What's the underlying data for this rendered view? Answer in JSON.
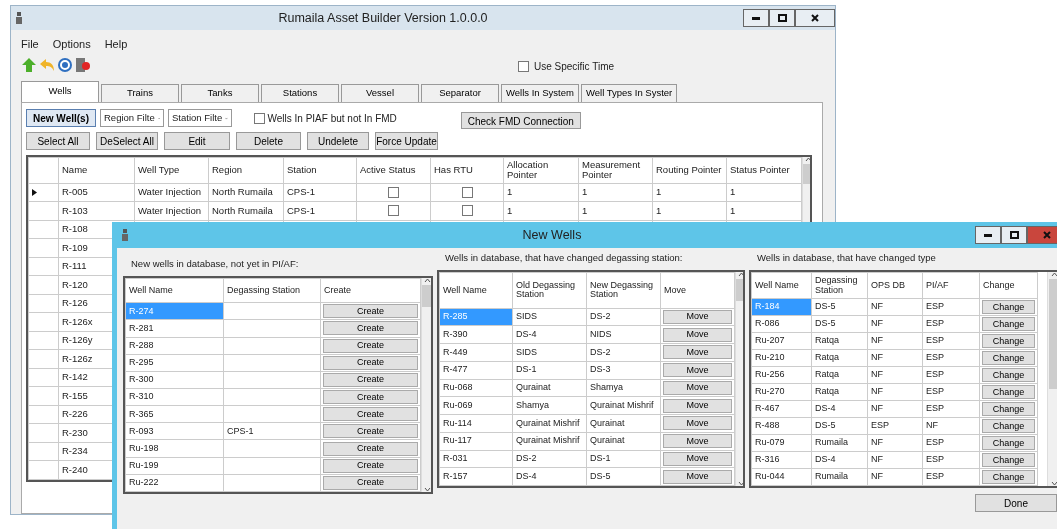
{
  "main_window": {
    "title": "Rumaila Asset Builder Version 1.0.0.0",
    "menu": [
      "File",
      "Options",
      "Help"
    ],
    "use_specific_time": {
      "label": "Use Specific Time",
      "checked": false
    },
    "tabs": [
      {
        "label": "Wells",
        "selected": true
      },
      {
        "label": "Trains",
        "selected": false
      },
      {
        "label": "Tanks",
        "selected": false
      },
      {
        "label": "Stations",
        "selected": false
      },
      {
        "label": "Vessel",
        "selected": false
      },
      {
        "label": "Separator",
        "selected": false
      },
      {
        "label": "Wells In System",
        "selected": false
      },
      {
        "label": "Well Types In Syster",
        "selected": false
      }
    ],
    "new_wells_button": "New Well(s)",
    "filters": [
      {
        "value": "Region Filte"
      },
      {
        "value": "Station Filte"
      }
    ],
    "piaf_checkbox": {
      "label": "Wells In PIAF but not In FMD",
      "checked": false
    },
    "check_fmd_button": "Check FMD Connection",
    "buttons": [
      "Select All",
      "DeSelect All",
      "Edit",
      "Delete",
      "Undelete",
      "Force Update"
    ],
    "table": {
      "columns": [
        "Name",
        "Well Type",
        "Region",
        "Station",
        "Active Status",
        "Has RTU",
        "Allocation Pointer",
        "Measurement Pointer",
        "Routing Pointer",
        "Status Pointer"
      ],
      "rows": [
        {
          "current": true,
          "name": "R-005",
          "well_type": "Water Injection",
          "region": "North Rumaila",
          "station": "CPS-1",
          "active_status": false,
          "has_rtu": false,
          "pointers": [
            "1",
            "1",
            "1",
            "1"
          ]
        },
        {
          "current": false,
          "name": "R-103",
          "well_type": "Water Injection",
          "region": "North Rumaila",
          "station": "CPS-1",
          "active_status": false,
          "has_rtu": false,
          "pointers": [
            "1",
            "1",
            "1",
            "1"
          ]
        },
        {
          "current": false,
          "name": "R-108"
        },
        {
          "current": false,
          "name": "R-109"
        },
        {
          "current": false,
          "name": "R-111"
        },
        {
          "current": false,
          "name": "R-120"
        },
        {
          "current": false,
          "name": "R-126"
        },
        {
          "current": false,
          "name": "R-126x"
        },
        {
          "current": false,
          "name": "R-126y"
        },
        {
          "current": false,
          "name": "R-126z"
        },
        {
          "current": false,
          "name": "R-142"
        },
        {
          "current": false,
          "name": "R-155"
        },
        {
          "current": false,
          "name": "R-226"
        },
        {
          "current": false,
          "name": "R-230"
        },
        {
          "current": false,
          "name": "R-234"
        },
        {
          "current": false,
          "name": "R-240"
        }
      ]
    }
  },
  "dialog": {
    "title": "New Wells",
    "panels": [
      {
        "label": "New wells in database, not yet in PI/AF:",
        "columns": [
          "Well Name",
          "Degassing Station",
          "Create"
        ],
        "rows": [
          {
            "cells": [
              "R-274",
              ""
            ],
            "action": "Create",
            "selected": true
          },
          {
            "cells": [
              "R-281",
              ""
            ],
            "action": "Create",
            "selected": false
          },
          {
            "cells": [
              "R-288",
              ""
            ],
            "action": "Create",
            "selected": false
          },
          {
            "cells": [
              "R-295",
              ""
            ],
            "action": "Create",
            "selected": false
          },
          {
            "cells": [
              "R-300",
              ""
            ],
            "action": "Create",
            "selected": false
          },
          {
            "cells": [
              "R-310",
              ""
            ],
            "action": "Create",
            "selected": false
          },
          {
            "cells": [
              "R-365",
              ""
            ],
            "action": "Create",
            "selected": false
          },
          {
            "cells": [
              "R-093",
              "CPS-1"
            ],
            "action": "Create",
            "selected": false
          },
          {
            "cells": [
              "Ru-198",
              ""
            ],
            "action": "Create",
            "selected": false
          },
          {
            "cells": [
              "Ru-199",
              ""
            ],
            "action": "Create",
            "selected": false
          },
          {
            "cells": [
              "Ru-222",
              ""
            ],
            "action": "Create",
            "selected": false
          }
        ]
      },
      {
        "label": "Wells in database, that have changed degassing station:",
        "columns": [
          "Well Name",
          "Old Degassing Station",
          "New Degassing Station",
          "Move"
        ],
        "rows": [
          {
            "cells": [
              "R-285",
              "SIDS",
              "DS-2"
            ],
            "action": "Move",
            "selected": true
          },
          {
            "cells": [
              "R-390",
              "DS-4",
              "NIDS"
            ],
            "action": "Move",
            "selected": false
          },
          {
            "cells": [
              "R-449",
              "SIDS",
              "DS-2"
            ],
            "action": "Move",
            "selected": false
          },
          {
            "cells": [
              "R-477",
              "DS-1",
              "DS-3"
            ],
            "action": "Move",
            "selected": false
          },
          {
            "cells": [
              "Ru-068",
              "Qurainat",
              "Shamya"
            ],
            "action": "Move",
            "selected": false
          },
          {
            "cells": [
              "Ru-069",
              "Shamya",
              "Qurainat Mishrif"
            ],
            "action": "Move",
            "selected": false
          },
          {
            "cells": [
              "Ru-114",
              "Qurainat Mishrif",
              "Qurainat"
            ],
            "action": "Move",
            "selected": false
          },
          {
            "cells": [
              "Ru-117",
              "Qurainat Mishrif",
              "Qurainat"
            ],
            "action": "Move",
            "selected": false
          },
          {
            "cells": [
              "R-031",
              "DS-2",
              "DS-1"
            ],
            "action": "Move",
            "selected": false
          },
          {
            "cells": [
              "R-157",
              "DS-4",
              "DS-5"
            ],
            "action": "Move",
            "selected": false
          }
        ]
      },
      {
        "label": "Wells in database, that have changed type",
        "columns": [
          "Well Name",
          "Degassing Station",
          "OPS DB",
          "PI/AF",
          "Change"
        ],
        "rows": [
          {
            "cells": [
              "R-184",
              "DS-5",
              "NF",
              "ESP"
            ],
            "action": "Change",
            "selected": true
          },
          {
            "cells": [
              "R-086",
              "DS-5",
              "NF",
              "ESP"
            ],
            "action": "Change",
            "selected": false
          },
          {
            "cells": [
              "Ru-207",
              "Ratqa",
              "NF",
              "ESP"
            ],
            "action": "Change",
            "selected": false
          },
          {
            "cells": [
              "Ru-210",
              "Ratqa",
              "NF",
              "ESP"
            ],
            "action": "Change",
            "selected": false
          },
          {
            "cells": [
              "Ru-256",
              "Ratqa",
              "NF",
              "ESP"
            ],
            "action": "Change",
            "selected": false
          },
          {
            "cells": [
              "Ru-270",
              "Ratqa",
              "NF",
              "ESP"
            ],
            "action": "Change",
            "selected": false
          },
          {
            "cells": [
              "R-467",
              "DS-4",
              "NF",
              "ESP"
            ],
            "action": "Change",
            "selected": false
          },
          {
            "cells": [
              "R-488",
              "DS-5",
              "ESP",
              "NF"
            ],
            "action": "Change",
            "selected": false
          },
          {
            "cells": [
              "Ru-079",
              "Rumaila",
              "NF",
              "ESP"
            ],
            "action": "Change",
            "selected": false
          },
          {
            "cells": [
              "R-316",
              "DS-4",
              "NF",
              "ESP"
            ],
            "action": "Change",
            "selected": false
          },
          {
            "cells": [
              "Ru-044",
              "Rumaila",
              "NF",
              "ESP"
            ],
            "action": "Change",
            "selected": false
          }
        ]
      }
    ],
    "done_button": "Done"
  }
}
